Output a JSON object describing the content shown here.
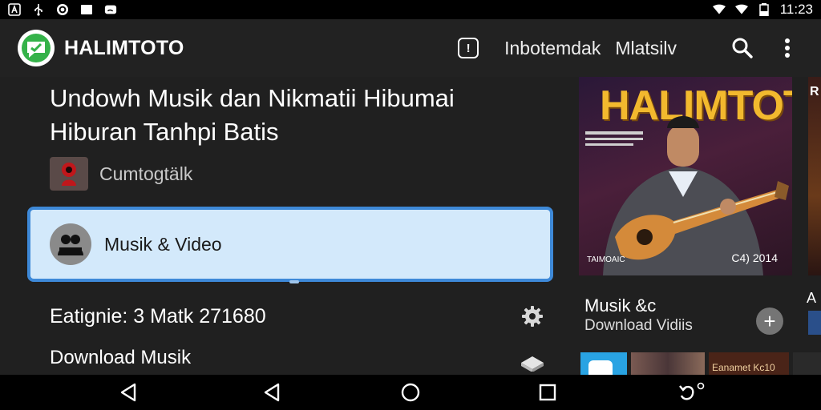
{
  "status_bar": {
    "time": "11:23",
    "left_icons": [
      "font-icon",
      "usb-icon",
      "sync-icon",
      "image-icon",
      "cast-icon"
    ],
    "right_icons": [
      "wifi-icon",
      "signal-icon",
      "battery-icon"
    ]
  },
  "app_bar": {
    "title": "HALIMTOTO",
    "info_label": "!",
    "links": [
      "Inbotemdak",
      "Mlatsilv"
    ]
  },
  "content": {
    "headline": "Undowh Musik dan Nikmatii Hibumai Hiburan Tanhpi Batis",
    "author": "Cumtogtälk",
    "category": "Musik & Video",
    "meta": "Eatignie:  3  Matk 271680",
    "download": "Download Musik"
  },
  "featured": {
    "title": "HALIMTOTO",
    "year": "C4) 2014",
    "small_text": "TAIMOAIC",
    "peek_letter": "R"
  },
  "right_panel": {
    "title": "Musik &c",
    "subtitle": "Download Vidiis",
    "add_label": "+",
    "peek_text": "A",
    "strip_caption": "Eanamet Kc10"
  },
  "colors": {
    "accent_border": "#3e89d8",
    "card_background": "#d3e9fb",
    "featured_title": "#f2b92e",
    "background": "#202020"
  }
}
